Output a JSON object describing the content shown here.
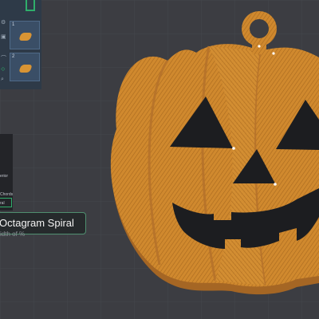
{
  "sidebar": {
    "plates": [
      {
        "number": "1"
      },
      {
        "number": "2"
      }
    ]
  },
  "settings": {
    "labels": [
      "erior",
      "Chords",
      "ral"
    ]
  },
  "dropdown": {
    "highlighted_option": "Octagram Spiral",
    "partial_next_text": "idth of %"
  },
  "colors": {
    "background": "#3c3d42",
    "pumpkin_fill": "#d0892e",
    "face_cutout": "#1c1d20",
    "accent_green": "#2fae6b"
  }
}
